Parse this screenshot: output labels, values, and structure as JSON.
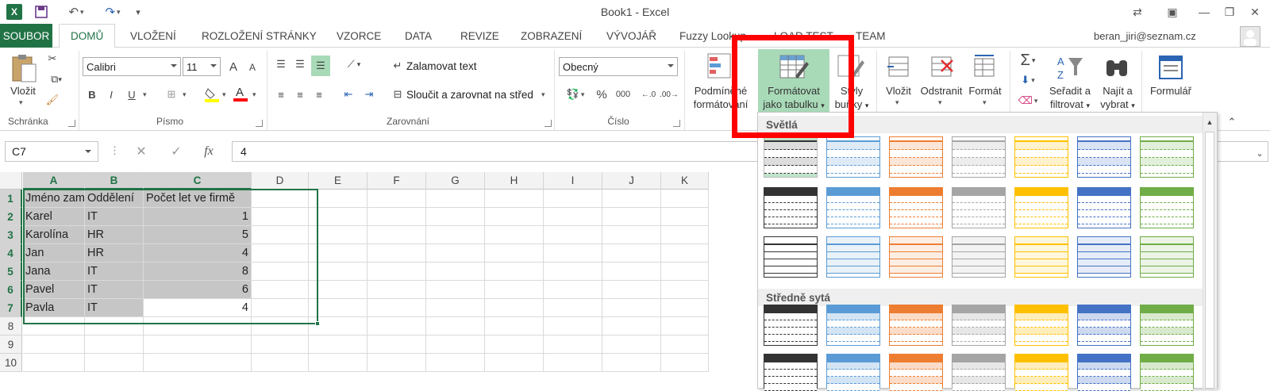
{
  "titlebar": {
    "title": "Book1 - Excel",
    "logo": "X",
    "logo_icon": "excel-icon",
    "save_icon": "save-icon",
    "undo_icon": "undo-icon",
    "redo_icon": "redo-icon"
  },
  "tabs": {
    "file": "SOUBOR",
    "items": [
      "DOMŮ",
      "VLOŽENÍ",
      "ROZLOŽENÍ STRÁNKY",
      "VZORCE",
      "DATA",
      "REVIZE",
      "ZOBRAZENÍ",
      "VÝVOJÁŘ",
      "Fuzzy Lookup",
      "LOAD TEST",
      "TEAM"
    ],
    "user": "beran_jiri@seznam.cz"
  },
  "ribbon": {
    "clipboard": {
      "paste": "Vložit",
      "group": "Schránka"
    },
    "font": {
      "name": "Calibri",
      "size": "11",
      "bold": "B",
      "italic": "I",
      "underline": "U",
      "grow": "A",
      "shrink": "A",
      "group": "Písmo"
    },
    "alignment": {
      "wrap": "Zalamovat text",
      "merge": "Sloučit a zarovnat na střed",
      "group": "Zarovnání"
    },
    "number": {
      "format": "Obecný",
      "percent": "%",
      "thousands": "000",
      "group": "Číslo"
    },
    "styles": {
      "cond1": "Podmíněné",
      "cond2": "formátování",
      "fmt1": "Formátovat",
      "fmt2": "jako tabulku",
      "cell1": "Styly",
      "cell2": "buňky"
    },
    "cells": {
      "insert": "Vložit",
      "delete": "Odstranit",
      "format": "Formát"
    },
    "editing": {
      "sum": "Σ",
      "sort1": "Seřadit a",
      "sort2": "filtrovat",
      "find1": "Najít a",
      "find2": "vybrat"
    },
    "form": {
      "label": "Formulář"
    }
  },
  "formula_bar": {
    "namebox": "C7",
    "cancel": "✕",
    "enter": "✓",
    "fx": "fx",
    "value": "4"
  },
  "grid": {
    "columns": [
      "A",
      "B",
      "C",
      "D",
      "E",
      "F",
      "G",
      "H",
      "I",
      "J",
      "K"
    ],
    "rows": [
      "1",
      "2",
      "3",
      "4",
      "5",
      "6",
      "7",
      "8",
      "9",
      "10"
    ],
    "data": [
      [
        "Jméno zaměstnance",
        "Oddělení",
        "Počet let ve firmě"
      ],
      [
        "Karel",
        "IT",
        "1"
      ],
      [
        "Karolína",
        "HR",
        "5"
      ],
      [
        "Jan",
        "HR",
        "4"
      ],
      [
        "Jana",
        "IT",
        "8"
      ],
      [
        "Pavel",
        "IT",
        "6"
      ],
      [
        "Pavla",
        "IT",
        "4"
      ]
    ]
  },
  "gallery": {
    "light": "Světlá",
    "medium": "Středně sytá",
    "colors": [
      "#333333",
      "#5b9bd5",
      "#ed7d31",
      "#a5a5a5",
      "#ffc000",
      "#4472c4",
      "#70ad47"
    ]
  }
}
